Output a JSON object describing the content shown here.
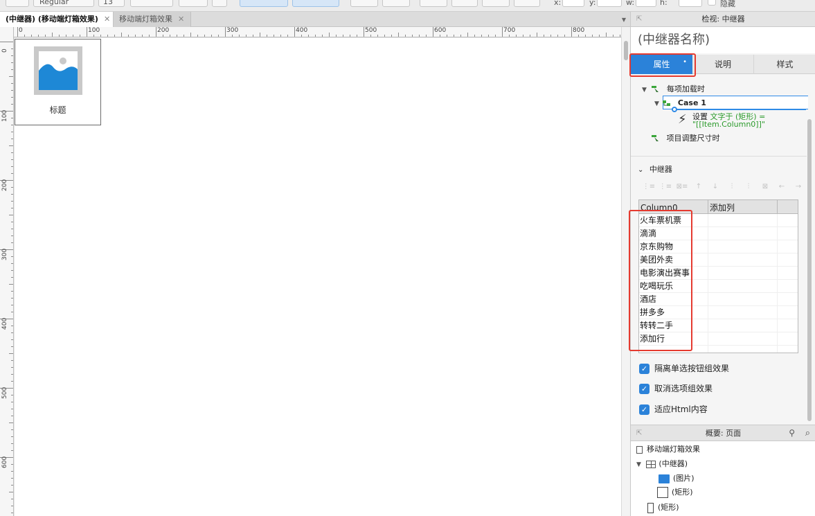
{
  "toolbar": {
    "font_style": "Regular",
    "font_size": "13",
    "x_label": "x:",
    "y_label": "y:",
    "w_label": "w:",
    "h_label": "h:",
    "hidden_label": "隐藏"
  },
  "tabs": [
    {
      "label": "(中继器) (移动端灯箱效果)"
    },
    {
      "label": "移动端灯箱效果"
    }
  ],
  "ruler": {
    "h_labels": [
      "0",
      "100",
      "200",
      "300",
      "400",
      "500",
      "600",
      "700",
      "800"
    ],
    "v_labels": [
      "0",
      "100",
      "200",
      "300",
      "400",
      "500",
      "600"
    ]
  },
  "canvas": {
    "widget_label": "标题"
  },
  "inspector": {
    "header": "检视: 中继器",
    "name": "(中继器名称)",
    "tabs": [
      "属性",
      "说明",
      "样式"
    ],
    "events": {
      "on_item_load": "每项加载时",
      "case1": "Case 1",
      "action_prefix": "设置",
      "action_detail": "文字于 (矩形) =",
      "action_value": "\"[[Item.Column0]]\"",
      "on_item_resize": "项目调整尺寸时"
    },
    "repeater_section": "中继器",
    "grid": {
      "columns": [
        "Column0",
        "添加列"
      ],
      "rows": [
        "火车票机票",
        "滴滴",
        "京东购物",
        "美团外卖",
        "电影演出赛事",
        "吃喝玩乐",
        "酒店",
        "拼多多",
        "转转二手",
        "添加行"
      ]
    },
    "options": [
      {
        "label": "隔离单选按钮组效果",
        "checked": true
      },
      {
        "label": "取消选项组效果",
        "checked": true
      },
      {
        "label": "适应Html内容",
        "checked": true
      }
    ]
  },
  "outline": {
    "header": "概要: 页面",
    "items": {
      "page": "移动端灯箱效果",
      "repeater": "(中继器)",
      "image": "(图片)",
      "rect_inner": "(矩形)",
      "rect_outer": "(矩形)"
    }
  },
  "colors": {
    "accent": "#2b82d9",
    "highlight_box": "#e53a2f",
    "action_text": "#2a9a2a"
  }
}
